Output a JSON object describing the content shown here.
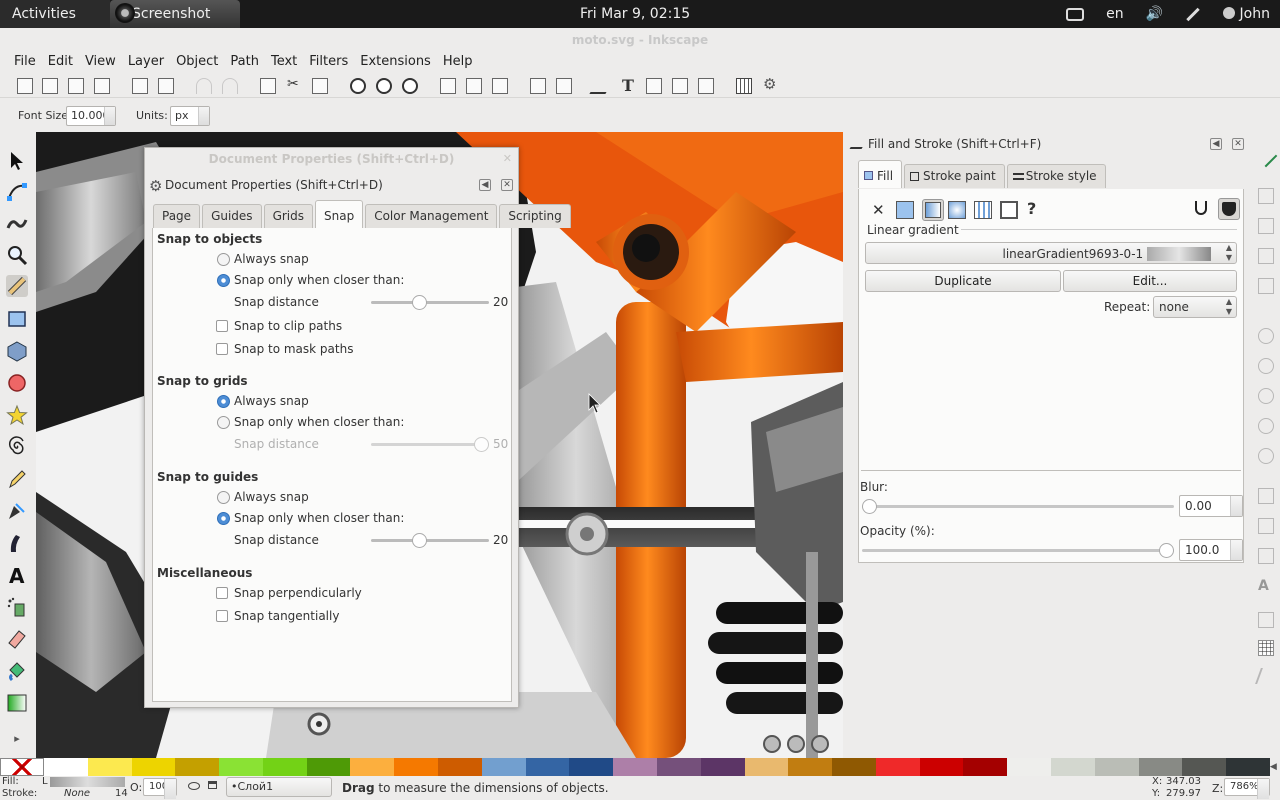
{
  "topbar": {
    "activities": "Activities",
    "app": "Screenshot",
    "clock": "Fri Mar  9, 02:15",
    "lang": "en",
    "user": "John"
  },
  "window": {
    "title": "moto.svg - Inkscape"
  },
  "menu": [
    "File",
    "Edit",
    "View",
    "Layer",
    "Object",
    "Path",
    "Text",
    "Filters",
    "Extensions",
    "Help"
  ],
  "controls": {
    "font_size_label": "Font Size:",
    "font_size_value": "10.000",
    "units_label": "Units:",
    "units_value": "px"
  },
  "docprops": {
    "shadow_title": "Document Properties (Shift+Ctrl+D)",
    "title": "Document Properties (Shift+Ctrl+D)",
    "tabs": [
      "Page",
      "Guides",
      "Grids",
      "Snap",
      "Color Management",
      "Scripting"
    ],
    "active_tab": "Snap",
    "objects": {
      "heading": "Snap to objects",
      "always": "Always snap",
      "closer": "Snap only when closer than:",
      "distance_label": "Snap distance",
      "distance_value": "20",
      "clip": "Snap to clip paths",
      "mask": "Snap to mask paths"
    },
    "grids": {
      "heading": "Snap to grids",
      "always": "Always snap",
      "closer": "Snap only when closer than:",
      "distance_label": "Snap distance",
      "distance_value": "50"
    },
    "guides": {
      "heading": "Snap to guides",
      "always": "Always snap",
      "closer": "Snap only when closer than:",
      "distance_label": "Snap distance",
      "distance_value": "20"
    },
    "misc": {
      "heading": "Miscellaneous",
      "perp": "Snap perpendicularly",
      "tang": "Snap tangentially"
    },
    "slider_levels": {
      "objects": 0.4,
      "grids": 1.0,
      "guides": 0.4
    }
  },
  "fillstroke": {
    "title": "Fill and Stroke (Shift+Ctrl+F)",
    "tabs": [
      "Fill",
      "Stroke paint",
      "Stroke style"
    ],
    "paint_type": "Linear gradient",
    "gradient_name": "linearGradient9693-0-1",
    "duplicate": "Duplicate",
    "edit": "Edit...",
    "repeat_label": "Repeat:",
    "repeat_value": "none",
    "blur_label": "Blur:",
    "blur_value": "0.00",
    "opacity_label": "Opacity (%):",
    "opacity_value": "100.0",
    "blur_level": 0.0,
    "opacity_level": 1.0
  },
  "status": {
    "fill_label": "Fill:",
    "fill_value": "L",
    "stroke_label": "Stroke:",
    "stroke_value": "None",
    "stroke_width": "14",
    "opacity_label": "O:",
    "opacity_value": "100",
    "layer": "•Слой1",
    "message_bold": "Drag",
    "message": " to measure the dimensions of objects.",
    "x_label": "X:",
    "x_value": "347.03",
    "y_label": "Y:",
    "y_value": "279.97",
    "zoom_label": "Z:",
    "zoom_value": "786%"
  },
  "palette": [
    "#ffffff",
    "#fce94f",
    "#edd400",
    "#c4a000",
    "#8ae234",
    "#73d216",
    "#4e9a06",
    "#fcaf3e",
    "#f57900",
    "#ce5c00",
    "#729fcf",
    "#3465a4",
    "#204a87",
    "#ad7fa8",
    "#75507b",
    "#5c3566",
    "#e9b96e",
    "#c17d11",
    "#8f5902",
    "#ef2929",
    "#cc0000",
    "#a40000",
    "#eeeeec",
    "#d3d7cf",
    "#babdb6",
    "#888a85",
    "#555753",
    "#2e3436"
  ]
}
